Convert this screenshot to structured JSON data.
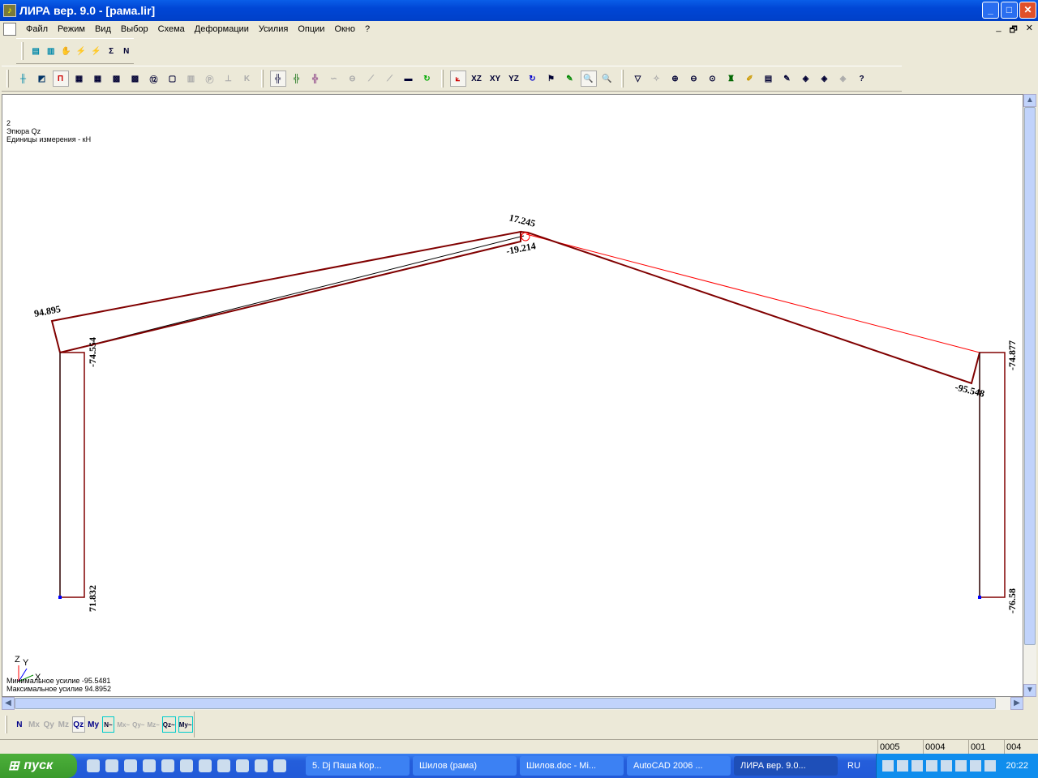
{
  "window": {
    "title": "ЛИРА  вер. 9.0 - [рама.lir]",
    "minimize": "_",
    "maximize": "□",
    "close": "✕"
  },
  "menu": [
    "Файл",
    "Режим",
    "Вид",
    "Выбор",
    "Схема",
    "Деформации",
    "Усилия",
    "Опции",
    "Окно",
    "?"
  ],
  "mdi": {
    "minimize": "_",
    "restore": "🗗",
    "close": "✕"
  },
  "toolbar1": [
    "load-1",
    "load-2",
    "hand",
    "lines",
    "weight",
    "sigma",
    "n-load"
  ],
  "canvas_info": {
    "case": "2",
    "diagram": "Эпюра Qz",
    "units": "Единицы измерения - кН",
    "min_label": "Минимальное усилие  -95.5481",
    "max_label": "Максимальное усилие  94.8952"
  },
  "axes": {
    "z": "Z",
    "y": "Y",
    "x": "X"
  },
  "values": {
    "left_top": "94.895",
    "left_col_top": "-74.554",
    "left_col_bottom": "71.832",
    "ridge_top": "17.245",
    "ridge_bottom": "-19.214",
    "right_rafter": "-95.548",
    "right_col_top": "-74.877",
    "right_col_bottom": "-76.58"
  },
  "force_buttons": [
    {
      "label": "N",
      "enabled": true
    },
    {
      "label": "Mx",
      "enabled": false
    },
    {
      "label": "Qy",
      "enabled": false
    },
    {
      "label": "Mz",
      "enabled": false
    },
    {
      "label": "Qz",
      "enabled": true,
      "active": true
    },
    {
      "label": "My",
      "enabled": true
    },
    {
      "label": "N~",
      "enabled": true
    },
    {
      "label": "Mx~",
      "enabled": false
    },
    {
      "label": "Qy~",
      "enabled": false
    },
    {
      "label": "Mz~",
      "enabled": false
    },
    {
      "label": "Qz~",
      "enabled": true
    },
    {
      "label": "My~",
      "enabled": true
    }
  ],
  "status": [
    "0005",
    "0004",
    "001",
    "004"
  ],
  "taskbar": {
    "start": "пуск",
    "tasks": [
      "5. Dj Паша Кор...",
      "Шилов (рама)",
      "Шилов.doc - Mi...",
      "AutoCAD 2006 ...",
      "ЛИРА  вер. 9.0..."
    ],
    "lang": "RU",
    "clock": "20:22"
  },
  "colors": {
    "diagram": "#800000",
    "axis_black": "#000000",
    "axis_red": "#ff0000"
  }
}
